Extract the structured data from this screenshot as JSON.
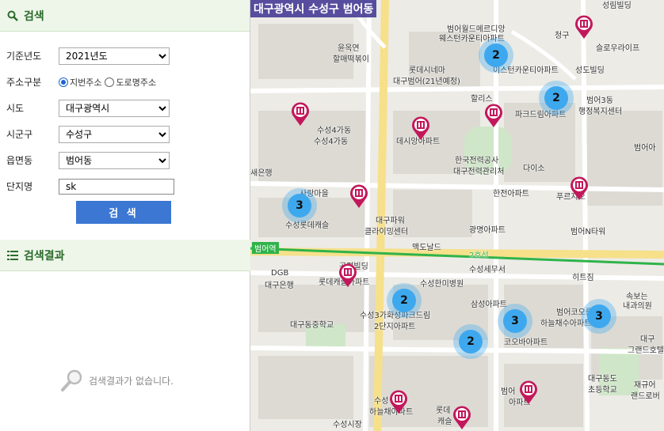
{
  "panel": {
    "search_title": "검색",
    "fields": {
      "year_label": "기준년도",
      "year_value": "2021년도",
      "addr_type_label": "주소구분",
      "addr_opt_jibun": "지번주소",
      "addr_opt_road": "도로명주소",
      "sido_label": "시도",
      "sido_value": "대구광역시",
      "sigungu_label": "시군구",
      "sigungu_value": "수성구",
      "emd_label": "읍면동",
      "emd_value": "범어동",
      "complex_label": "단지명",
      "complex_value": "sk"
    },
    "search_button": "검 색",
    "results_title": "검색결과",
    "empty_message": "검색결과가 없습니다."
  },
  "map": {
    "region_title": "대구광역시 수성구 범어동",
    "accent": "#3ea8ee",
    "pin_color": "#c2185b",
    "labels": [
      "성림빌딩",
      "범어월드메르디앙",
      "웨스턴카운티아파트",
      "청구",
      "슬로우라이프",
      "윤옥연",
      "할매떡볶이",
      "롯데시네마",
      "대구범어(21년예정)",
      "이스턴카운티아파트",
      "성도빌딩",
      "할리스",
      "범어3동",
      "행정복지센터",
      "파크드림아파트",
      "수성4가동",
      "데시앙아파트",
      "범어아",
      "다이소",
      "한국전력공사",
      "대구전력관리처",
      "한전아파트",
      "새은행",
      "사랑마을",
      "푸르지오",
      "수성롯데캐슬",
      "대구파워",
      "클라이밍센터",
      "광명아파트",
      "범어N타워",
      "맥도날드",
      "2호선",
      "범어역",
      "DGB",
      "대구은행",
      "롯데캐슬아파트",
      "수성세무서",
      "히트짐",
      "속보는",
      "내과의원",
      "수성한미병원",
      "삼성아파트",
      "범어코오롱",
      "하늘채수아파트",
      "수성3가화성파크드림",
      "2단지아파트",
      "대구동중학교",
      "코오바아파트",
      "대구",
      "그랜드호텔",
      "대구동도",
      "초등학교",
      "재규어",
      "랜드로버",
      "수성",
      "하늘채아파트",
      "롯데",
      "캐슬",
      "수성시장",
      "범어",
      "아파트",
      "수성4가동",
      "공평빌딩"
    ],
    "clusters": [
      2,
      2,
      3,
      2,
      2,
      3,
      3
    ]
  }
}
